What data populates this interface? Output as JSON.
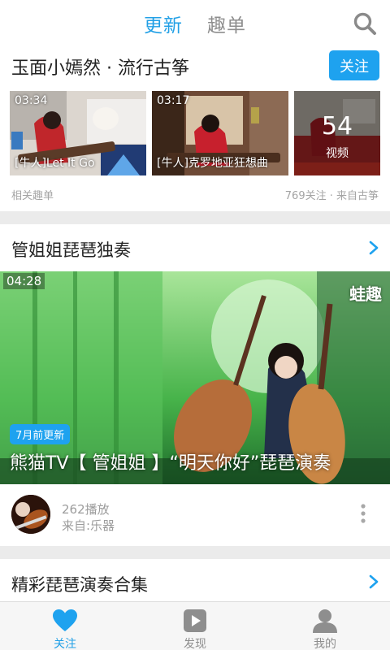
{
  "top_tabs": [
    {
      "label": "更新",
      "active": true
    },
    {
      "label": "趣单",
      "active": false
    }
  ],
  "icons": {
    "search": "search-icon",
    "chevron": "chevron-right-icon",
    "more": "more-vertical-icon",
    "nav_follow": "heart-icon",
    "nav_discover": "play-icon",
    "nav_me": "person-icon"
  },
  "colors": {
    "accent": "#1ea2ef",
    "muted": "#a4a4a4",
    "background": "#ebebeb"
  },
  "section1": {
    "title": "玉面小嫣然 · 流行古筝",
    "follow_label": "关注",
    "thumbnails": [
      {
        "duration": "03:34",
        "caption": "[牛人]Let It Go"
      },
      {
        "duration": "03:17",
        "caption": "[牛人]克罗地亚狂想曲"
      }
    ],
    "more": {
      "count": "54",
      "label": "视频"
    },
    "meta_left": "相关趣单",
    "meta_right": "769关注 · 来自古筝"
  },
  "section2": {
    "title": "管姐姐琵琶独奏",
    "video": {
      "duration": "04:28",
      "watermark": "蛙趣",
      "badge": "7月前更新",
      "title": "熊猫TV【 管姐姐 】“明天你好”琵琶演奏"
    },
    "plays": "262播放",
    "source": "来自:乐器"
  },
  "section3": {
    "title": "精彩琵琶演奏合集"
  },
  "bottom_nav": [
    {
      "label": "关注",
      "active": true
    },
    {
      "label": "发现",
      "active": false
    },
    {
      "label": "我的",
      "active": false
    }
  ]
}
